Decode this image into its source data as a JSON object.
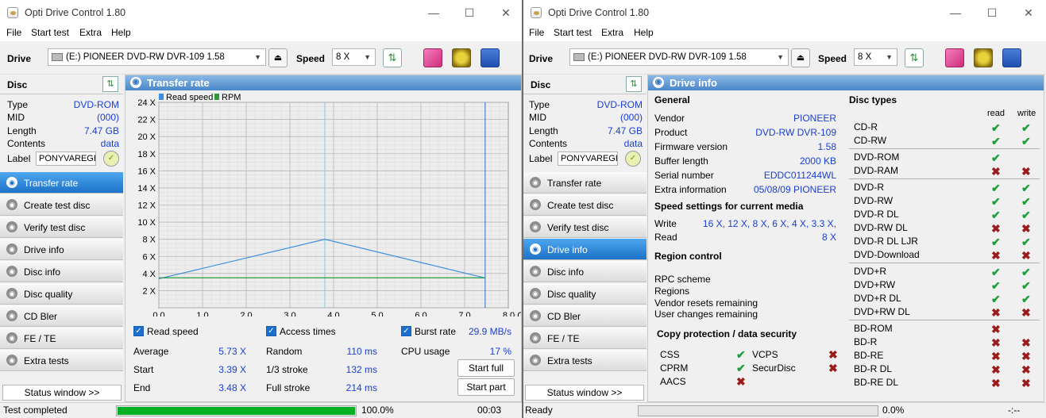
{
  "left": {
    "title": "Opti Drive Control 1.80",
    "menu": [
      "File",
      "Start test",
      "Extra",
      "Help"
    ],
    "drive_label": "Drive",
    "drive_value": "(E:)  PIONEER DVD-RW  DVR-109 1.58",
    "speed_label": "Speed",
    "speed_value": "8 X",
    "disc_header": "Disc",
    "disc": {
      "type_label": "Type",
      "type_value": "DVD-ROM",
      "mid_label": "MID",
      "mid_value": "(000)",
      "length_label": "Length",
      "length_value": "7.47 GB",
      "contents_label": "Contents",
      "contents_value": "data",
      "label_label": "Label",
      "label_value": "PONYVAREGEN"
    },
    "nav": [
      "Transfer rate",
      "Create test disc",
      "Verify test disc",
      "Drive info",
      "Disc info",
      "Disc quality",
      "CD Bler",
      "FE / TE",
      "Extra tests"
    ],
    "active_nav": "Transfer rate",
    "status_window": "Status window >>",
    "status_text": "Test completed",
    "progress_percent": 100.0,
    "progress_label": "100.0%",
    "elapsed": "00:03"
  },
  "transfer": {
    "header": "Transfer rate",
    "read_speed_check": "Read speed",
    "access_times_check": "Access times",
    "burst_rate_check": "Burst rate",
    "burst_rate_value": "29.9 MB/s",
    "average_label": "Average",
    "average_value": "5.73 X",
    "start_label": "Start",
    "start_value": "3.39 X",
    "end_label": "End",
    "end_value": "3.48 X",
    "random_label": "Random",
    "random_value": "110 ms",
    "third_label": "1/3 stroke",
    "third_value": "132 ms",
    "full_label": "Full stroke",
    "full_value": "214 ms",
    "cpu_label": "CPU usage",
    "cpu_value": "17 %",
    "start_full_button": "Start full",
    "start_part_button": "Start part"
  },
  "chart_data": {
    "type": "line",
    "legend": [
      "Read speed",
      "RPM"
    ],
    "legend_colors": [
      "#3a8fe0",
      "#2a9a3a"
    ],
    "x_ticks": [
      "0.0",
      "1.0",
      "2.0",
      "3.0",
      "4.0",
      "5.0",
      "6.0",
      "7.0",
      "8.0 GB"
    ],
    "y_ticks": [
      "2 X",
      "4 X",
      "6 X",
      "8 X",
      "10 X",
      "12 X",
      "14 X",
      "16 X",
      "18 X",
      "20 X",
      "22 X",
      "24 X"
    ],
    "xlim": [
      0,
      8
    ],
    "ylim": [
      0,
      24
    ],
    "series": [
      {
        "name": "Read speed",
        "x": [
          0,
          3.8,
          7.47
        ],
        "y": [
          3.39,
          8.0,
          3.48
        ]
      },
      {
        "name": "RPM",
        "x": [
          0,
          7.47
        ],
        "y": [
          3.5,
          3.5
        ]
      }
    ],
    "markers": [
      3.8,
      7.47
    ],
    "grid": true
  },
  "right": {
    "title": "Opti Drive Control 1.80",
    "menu": [
      "File",
      "Start test",
      "Extra",
      "Help"
    ],
    "drive_label": "Drive",
    "drive_value": "(E:)  PIONEER DVD-RW  DVR-109 1.58",
    "speed_label": "Speed",
    "speed_value": "8 X",
    "disc_header": "Disc",
    "disc": {
      "type_label": "Type",
      "type_value": "DVD-ROM",
      "mid_label": "MID",
      "mid_value": "(000)",
      "length_label": "Length",
      "length_value": "7.47 GB",
      "contents_label": "Contents",
      "contents_value": "data",
      "label_label": "Label",
      "label_value": "PONYVAREGEN"
    },
    "nav": [
      "Transfer rate",
      "Create test disc",
      "Verify test disc",
      "Drive info",
      "Disc info",
      "Disc quality",
      "CD Bler",
      "FE / TE",
      "Extra tests"
    ],
    "active_nav": "Drive info",
    "status_window": "Status window >>",
    "status_text": "Ready",
    "progress_percent": 0.0,
    "progress_label": "0.0%",
    "elapsed": "-:--"
  },
  "drive_info": {
    "header": "Drive info",
    "general_title": "General",
    "vendor_label": "Vendor",
    "vendor_value": "PIONEER",
    "product_label": "Product",
    "product_value": "DVD-RW  DVR-109",
    "firmware_label": "Firmware version",
    "firmware_value": "1.58",
    "buffer_label": "Buffer length",
    "buffer_value": "2000 KB",
    "serial_label": "Serial number",
    "serial_value": "EDDC011244WL",
    "extra_label": "Extra information",
    "extra_value": "05/08/09  PIONEER",
    "speed_title": "Speed settings for current media",
    "write_label": "Write",
    "write_value": "16 X, 12 X, 8 X, 6 X, 4 X, 3.3 X,",
    "read_label": "Read",
    "read_value": "8 X",
    "region_title": "Region control",
    "rpc_label": "RPC scheme",
    "regions_label": "Regions",
    "vendor_resets_label": "Vendor resets remaining",
    "user_changes_label": "User changes remaining",
    "copy_title": "Copy protection / data security",
    "css_label": "CSS",
    "cprm_label": "CPRM",
    "aacs_label": "AACS",
    "vcps_label": "VCPS",
    "securdisc_label": "SecurDisc",
    "disc_types_title": "Disc types",
    "read_col": "read",
    "write_col": "write",
    "disc_types": [
      {
        "name": "CD-R",
        "read": "yes",
        "write": "yes"
      },
      {
        "name": "CD-RW",
        "read": "yes",
        "write": "yes"
      },
      {
        "name": "DVD-ROM",
        "read": "yes",
        "write": ""
      },
      {
        "name": "DVD-RAM",
        "read": "no",
        "write": "no"
      },
      {
        "name": "DVD-R",
        "read": "yes",
        "write": "yes"
      },
      {
        "name": "DVD-RW",
        "read": "yes",
        "write": "yes"
      },
      {
        "name": "DVD-R DL",
        "read": "yes",
        "write": "yes"
      },
      {
        "name": "DVD-RW DL",
        "read": "no",
        "write": "no"
      },
      {
        "name": "DVD-R DL LJR",
        "read": "yes",
        "write": "yes"
      },
      {
        "name": "DVD-Download",
        "read": "no",
        "write": "no"
      },
      {
        "name": "DVD+R",
        "read": "yes",
        "write": "yes"
      },
      {
        "name": "DVD+RW",
        "read": "yes",
        "write": "yes"
      },
      {
        "name": "DVD+R DL",
        "read": "yes",
        "write": "yes"
      },
      {
        "name": "DVD+RW DL",
        "read": "no",
        "write": "no"
      },
      {
        "name": "BD-ROM",
        "read": "no",
        "write": ""
      },
      {
        "name": "BD-R",
        "read": "no",
        "write": "no"
      },
      {
        "name": "BD-RE",
        "read": "no",
        "write": "no"
      },
      {
        "name": "BD-R DL",
        "read": "no",
        "write": "no"
      },
      {
        "name": "BD-RE DL",
        "read": "no",
        "write": "no"
      }
    ]
  }
}
